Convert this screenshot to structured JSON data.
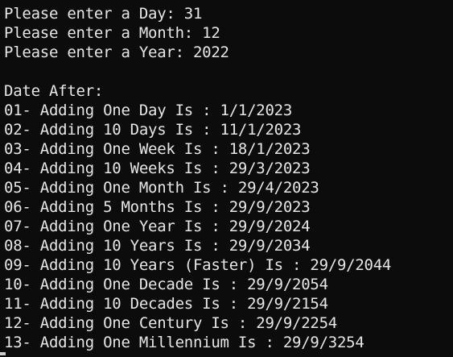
{
  "console": {
    "lines": [
      "Please enter a Day: 31",
      "Please enter a Month: 12",
      "Please enter a Year: 2022",
      "",
      "Date After:",
      "01- Adding One Day Is : 1/1/2023",
      "02- Adding 10 Days Is : 11/1/2023",
      "03- Adding One Week Is : 18/1/2023",
      "04- Adding 10 Weeks Is : 29/3/2023",
      "05- Adding One Month Is : 29/4/2023",
      "06- Adding 5 Months Is : 29/9/2023",
      "07- Adding One Year Is : 29/9/2024",
      "08- Adding 10 Years Is : 29/9/2034",
      "09- Adding 10 Years (Faster) Is : 29/9/2044",
      "10- Adding One Decade Is : 29/9/2054",
      "11- Adding 10 Decades Is : 29/9/2154",
      "12- Adding One Century Is : 29/9/2254",
      "13- Adding One Millennium Is : 29/9/3254"
    ]
  },
  "colors": {
    "background": "#0c0c0c",
    "text": "#e6e6e6"
  }
}
